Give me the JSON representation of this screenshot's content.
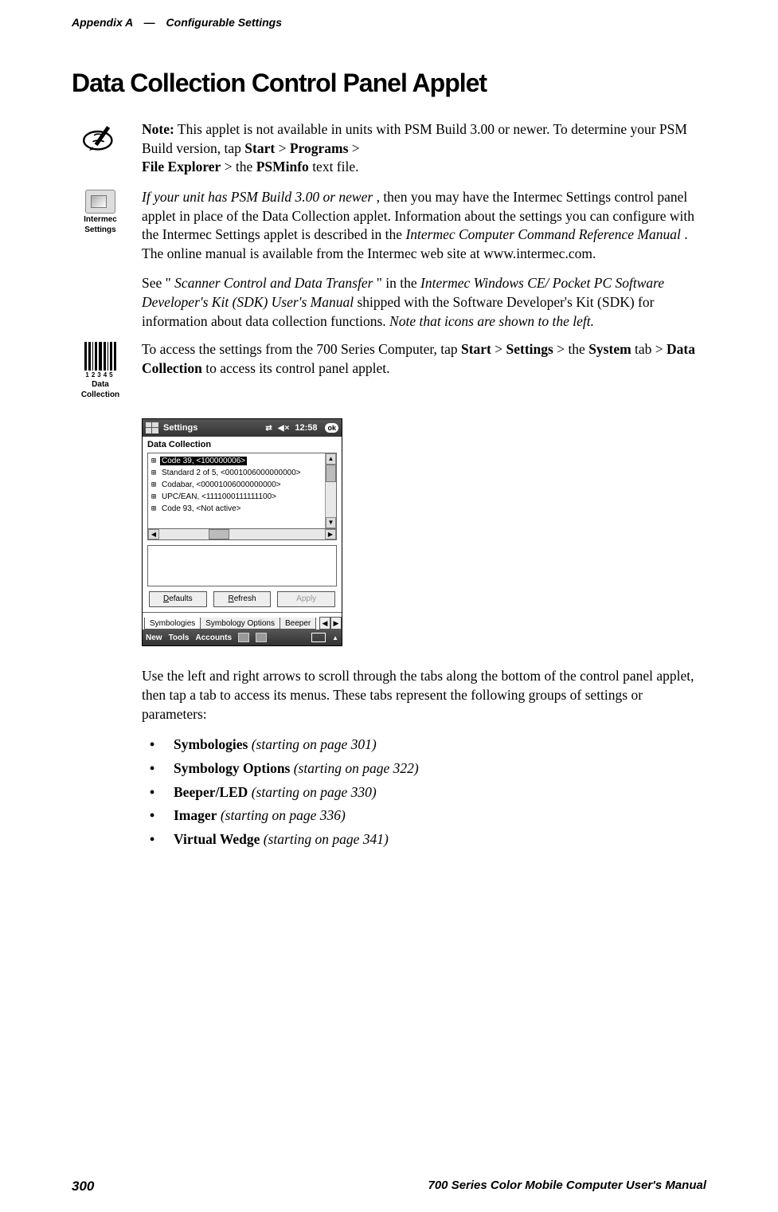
{
  "header": {
    "appendix": "Appendix  A",
    "separator": "—",
    "chapter": "Configurable Settings"
  },
  "title": "Data Collection Control Panel Applet",
  "note": {
    "label": "Note:",
    "body1": " This applet is not available in units with PSM Build 3.00 or newer. To determine your PSM Build version, tap ",
    "start": "Start",
    "gt1": " > ",
    "programs": "Programs",
    "gt2": " > ",
    "fileexp": "File Explorer",
    "gt3": " > the ",
    "psminfo": "PSMinfo",
    "tail": " text file."
  },
  "intermec": {
    "label1": "Intermec",
    "label2": "Settings",
    "lead_i": "If your unit has PSM Build 3.00 or newer",
    "body1": ", then you may have the Intermec Settings control panel applet in place of the Data Collection applet. Information about the settings you can configure with the Intermec Settings applet is described in the ",
    "ref_i": "Intermec Computer Command Reference Manual",
    "body2": ". The online manual is available from the Intermec web site at www.intermec.com.",
    "see1": "See \"",
    "see_i1": "Scanner Control and Data Transfer",
    "see2": "\" in the ",
    "see_i2": "Intermec Windows CE/ Pocket PC Software Developer's Kit (SDK) User's Manual",
    "see3": " shipped with the Software Developer's Kit (SDK) for information about data collection functions. ",
    "see_i3": "Note that icons are shown to the left."
  },
  "access": {
    "barcode_label1": "Data",
    "barcode_label2": "Collection",
    "barcode_digits": "12345",
    "body1": "To access the settings from the 700 Series Computer, tap ",
    "start": "Start",
    "gt1": " > ",
    "settings": "Settings",
    "gt2": " > the ",
    "system": "System",
    "body2": " tab > ",
    "datacol": "Data Collection",
    "body3": " to access its control panel applet."
  },
  "screenshot": {
    "titlebar": {
      "label": "Settings",
      "clock": "12:58",
      "ok": "ok"
    },
    "panel_title": "Data Collection",
    "tree": [
      "Code 39, <100000006>",
      "Standard 2 of 5, <0001006000000000>",
      "Codabar, <00001006000000000>",
      "UPC/EAN, <1111000111111100>",
      "Code 93, <Not active>"
    ],
    "buttons": {
      "defaults": "Defaults",
      "refresh": "Refresh",
      "apply": "Apply"
    },
    "tabs": {
      "t1": "Symbologies",
      "t2": "Symbology Options",
      "t3": "Beeper"
    },
    "bottom": {
      "m1": "New",
      "m2": "Tools",
      "m3": "Accounts"
    }
  },
  "after_shot": "Use the left and right arrows to scroll through the tabs along the bottom of the control panel applet, then tap a tab to access its menus. These tabs represent the following groups of settings or parameters:",
  "bullets": [
    {
      "b": "Symbologies",
      "i": " (starting on page 301)"
    },
    {
      "b": "Symbology Options",
      "i": " (starting on page 322)"
    },
    {
      "b": "Beeper/LED",
      "i": " (starting on page 330)"
    },
    {
      "b": "Imager",
      "i": " (starting on page 336)"
    },
    {
      "b": "Virtual Wedge",
      "i": " (starting on page 341)"
    }
  ],
  "footer": {
    "page": "300",
    "manual": "700 Series Color Mobile Computer User's Manual"
  }
}
